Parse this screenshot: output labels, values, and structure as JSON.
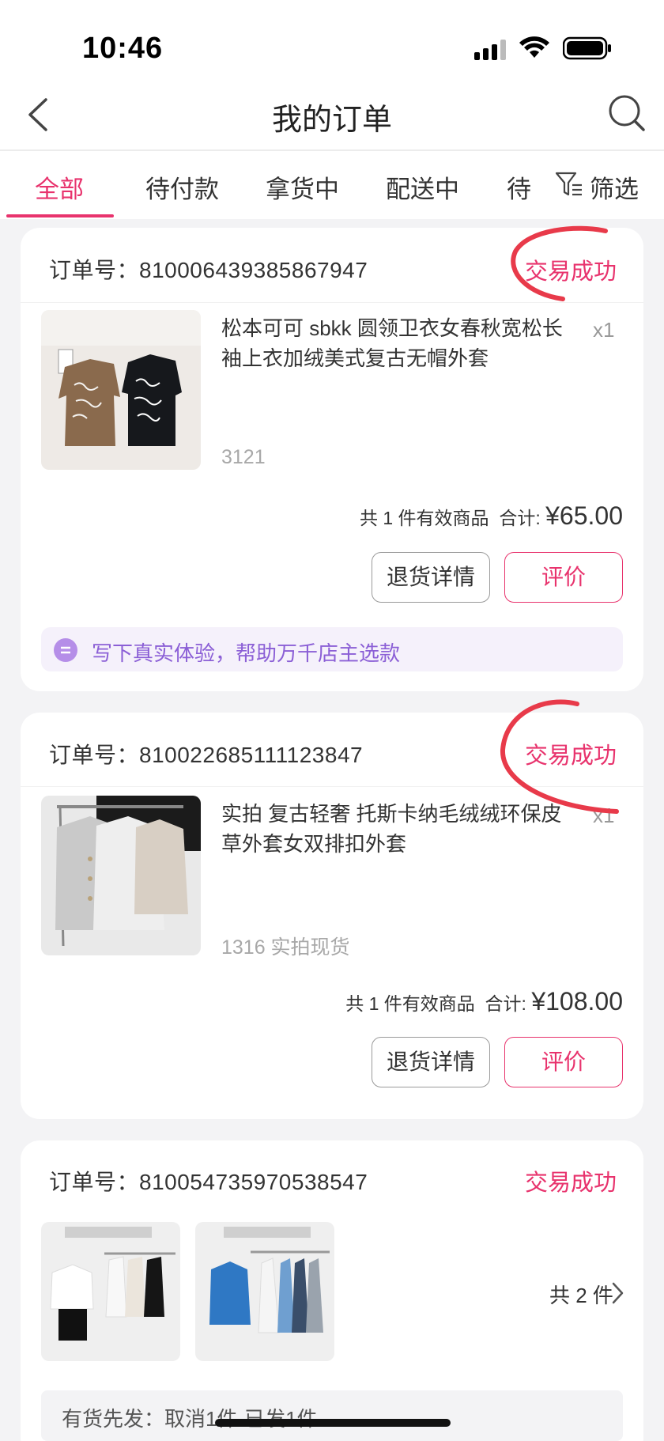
{
  "status_bar": {
    "time": "10:46"
  },
  "nav": {
    "title": "我的订单"
  },
  "tabs": [
    {
      "label": "全部",
      "active": true
    },
    {
      "label": "待付款"
    },
    {
      "label": "拿货中"
    },
    {
      "label": "配送中"
    },
    {
      "label": "待"
    }
  ],
  "filter_label": "筛选",
  "orders": [
    {
      "order_label": "订单号：",
      "order_no": "810006439385867947",
      "status": "交易成功",
      "product_name": "松本可可 sbkk 圆领卫衣女春秋宽松长袖上衣加绒美式复古无帽外套",
      "qty": "x1",
      "spec": "3121",
      "summary_count": "共 1 件有效商品",
      "summary_total_label": "合计:",
      "currency": "¥",
      "total": "65.00",
      "btn_return": "退货详情",
      "btn_review": "评价",
      "tip": "写下真实体验，帮助万千店主选款"
    },
    {
      "order_label": "订单号：",
      "order_no": "810022685111123847",
      "status": "交易成功",
      "product_name": "实拍 复古轻奢 托斯卡纳毛绒绒环保皮草外套女双排扣外套",
      "qty": "x1",
      "spec": "1316 实拍现货",
      "summary_count": "共 1 件有效商品",
      "summary_total_label": "合计:",
      "currency": "¥",
      "total": "108.00",
      "btn_return": "退货详情",
      "btn_review": "评价"
    },
    {
      "order_label": "订单号：",
      "order_no": "810054735970538547",
      "status": "交易成功",
      "item_count": "共 2 件",
      "shipping_note": "有货先发：取消1件·已发1件"
    }
  ],
  "colors": {
    "accent": "#e8336d",
    "tip_purple": "#8b5fd6",
    "annotation_red": "#e83a4a"
  }
}
